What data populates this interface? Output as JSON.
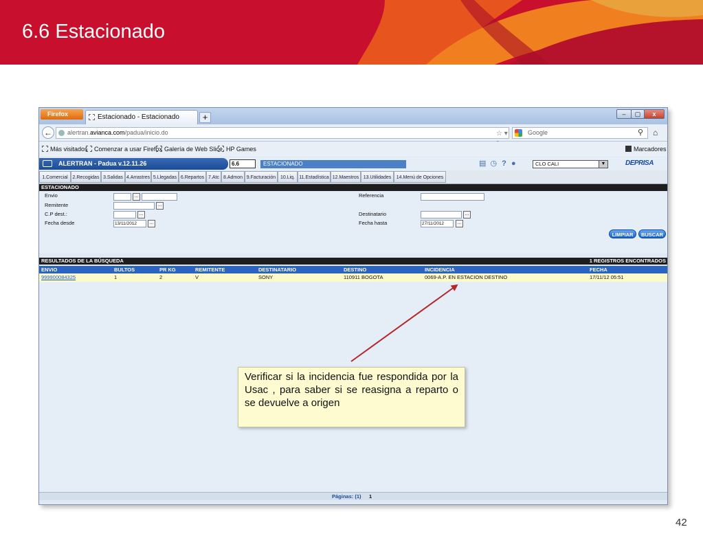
{
  "slide": {
    "title": "6.6 Estacionado",
    "page_number": "42"
  },
  "browser": {
    "menu_button": "Firefox",
    "tab_title": "Estacionado - Estacionado",
    "new_tab": "+",
    "window_controls": [
      "–",
      "▢",
      "x"
    ],
    "url": {
      "prefix": "alertran.",
      "domain": "avianca.com",
      "path": "/padua/inicio.do"
    },
    "search_placeholder": "Google",
    "bookmarks": [
      "Más visitados",
      "Comenzar a usar Firefox",
      "Galería de Web Slice",
      "HP Games"
    ],
    "bookmarks_menu": "Marcadores"
  },
  "app": {
    "title": "ALERTRAN - Padua  v.12.11.26",
    "screen_code": "6.6",
    "module_name": "ESTACIONADO",
    "office": "CLO CALI",
    "logo": "DEPRISA",
    "menu": [
      "1.Comercial",
      "2.Recogidas",
      "3.Salidas",
      "4.Arrastres",
      "5.Llegadas",
      "6.Repartos",
      "7.Atc",
      "8.Admon",
      "9.Facturación",
      "10.Liq.",
      "11.Estadística",
      "12.Maestros",
      "13.Utilidades",
      "14.Menú de Opciones"
    ]
  },
  "form": {
    "section_title": "ESTACIONADO",
    "labels": {
      "envio": "Envio",
      "remitente": "Remitente",
      "cp_dest": "C.P dest.:",
      "fecha_desde": "Fecha desde",
      "referencia": "Referencia",
      "destinatario": "Destinatario",
      "fecha_hasta": "Fecha hasta"
    },
    "values": {
      "fecha_desde": "13/11/2012",
      "fecha_hasta": "27/11/2012"
    },
    "lookup_label": "...",
    "buttons": {
      "clear": "LIMPIAR",
      "search": "BUSCAR"
    }
  },
  "results": {
    "section_title": "RESULTADOS DE LA BÚSQUEDA",
    "count_text": "1 REGISTROS ENCONTRADOS",
    "columns": [
      "ENVIO",
      "BULTOS",
      "PR KG",
      "REMITENTE",
      "DESTINATARIO",
      "DESTINO",
      "INCIDENCIA",
      "FECHA"
    ],
    "rows": [
      [
        "999900084325",
        "1",
        "2",
        "V",
        "SONY",
        "110911 BOGOTA",
        "0069-A.P. EN ESTACION DESTINO",
        "17/11/12 05:51"
      ]
    ],
    "pagination_label": "Páginas: (1)",
    "pagination_value": "1"
  },
  "callout": {
    "text": "Verificar si la incidencia fue respondida por la Usac , para saber si se reasigna a reparto o se devuelve a origen"
  },
  "icons": [
    "bus-icon",
    "calendar-icon",
    "clock-icon",
    "help-icon",
    "user-icon",
    "globe-icon",
    "star-icon",
    "reload-icon",
    "search-icon",
    "home-icon",
    "bookmark-icon"
  ]
}
